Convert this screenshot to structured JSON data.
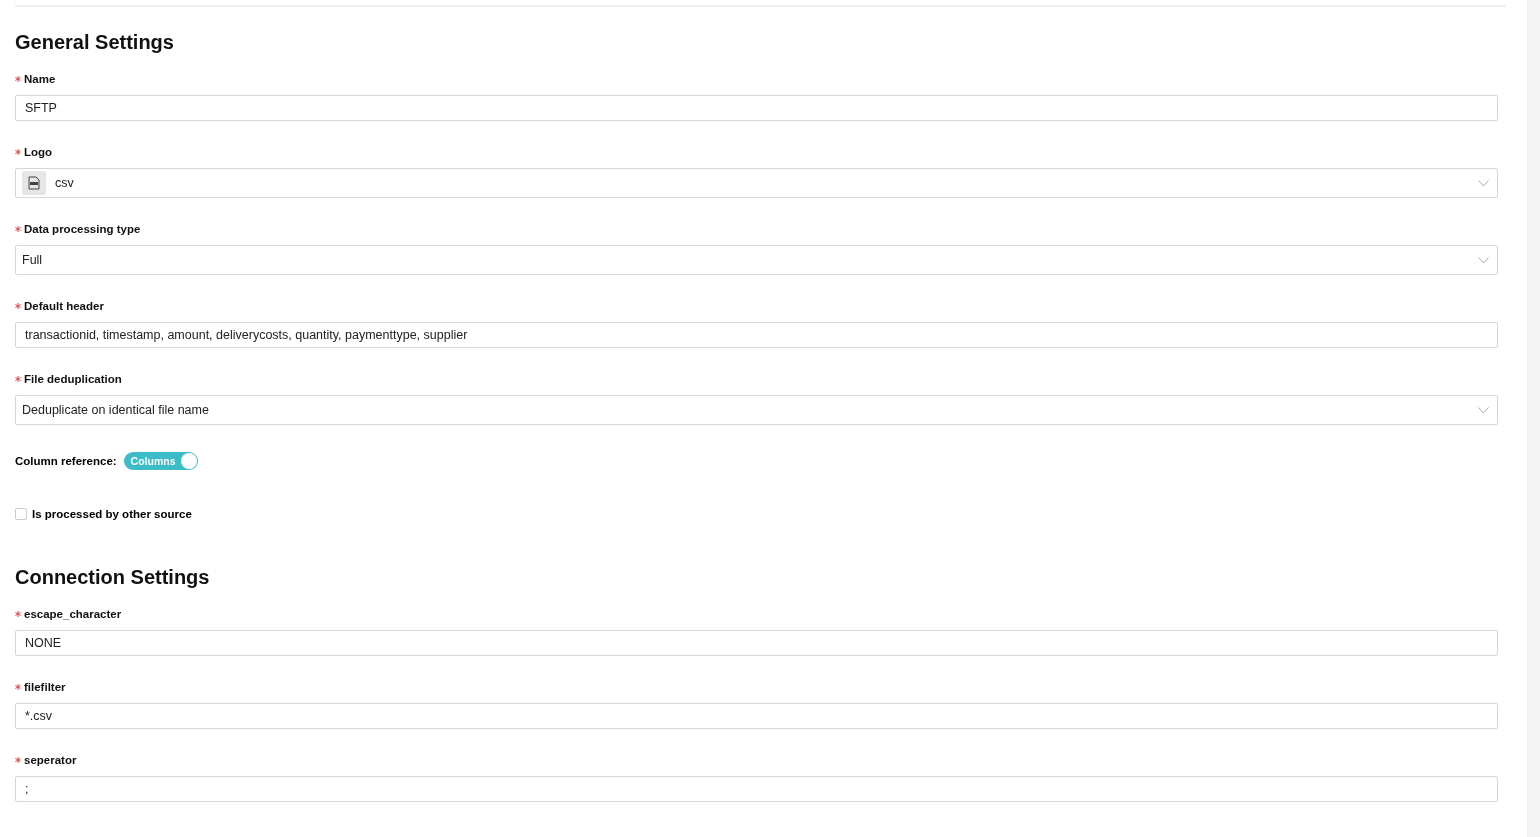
{
  "sections": [
    {
      "title": "General Settings",
      "items": [
        {
          "kind": "text",
          "label": "Name",
          "required": true,
          "value": "SFTP"
        },
        {
          "kind": "select",
          "label": "Logo",
          "required": true,
          "value": "csv",
          "logo": true
        },
        {
          "kind": "select",
          "label": "Data processing type",
          "required": true,
          "value": "Full"
        },
        {
          "kind": "text",
          "label": "Default header",
          "required": true,
          "value": "transactionid, timestamp, amount, deliverycosts, quantity, paymenttype, supplier"
        },
        {
          "kind": "select",
          "label": "File deduplication",
          "required": true,
          "value": "Deduplicate on identical file name"
        },
        {
          "kind": "toggle",
          "label": "Column reference:",
          "value": "Columns",
          "on": true
        },
        {
          "kind": "checkbox",
          "label": "Is processed by other source",
          "checked": false
        }
      ]
    },
    {
      "title": "Connection Settings",
      "items": [
        {
          "kind": "text",
          "label": "escape_character",
          "required": true,
          "value": "NONE"
        },
        {
          "kind": "text",
          "label": "filefilter",
          "required": true,
          "value": "*.csv"
        },
        {
          "kind": "text",
          "label": "seperator",
          "required": true,
          "value": ";"
        }
      ]
    }
  ]
}
